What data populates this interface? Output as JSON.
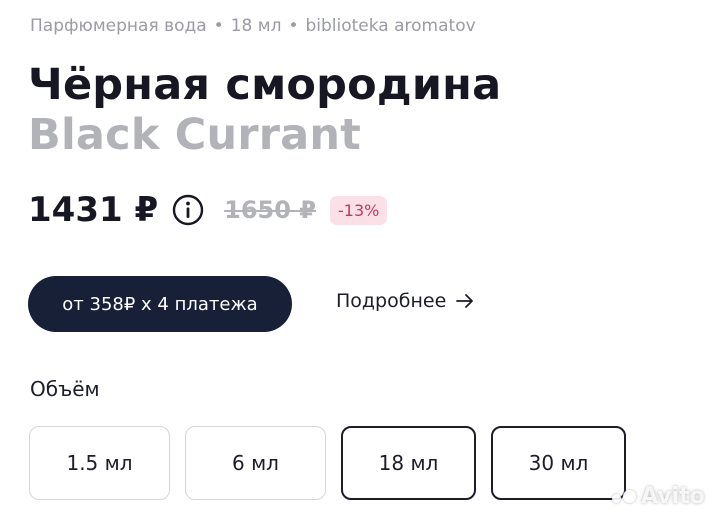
{
  "breadcrumb": {
    "type": "Парфюмерная вода",
    "volume": "18 мл",
    "brand": "biblioteka aromatov",
    "separator": "•"
  },
  "product": {
    "title": "Чёрная смородина",
    "subtitle": "Black Currant"
  },
  "pricing": {
    "price": "1431 ₽",
    "old_price": "1650 ₽",
    "discount": "-13%",
    "info_icon": "info-circle-icon"
  },
  "installment": {
    "button_label": "от 358₽ x 4 платежа",
    "more_label": "Подробнее",
    "more_icon": "arrow-right-icon"
  },
  "volume": {
    "label": "Объём",
    "options": [
      {
        "label": "1.5 мл",
        "state": "default"
      },
      {
        "label": "6 мл",
        "state": "default"
      },
      {
        "label": "18 мл",
        "state": "outlined"
      },
      {
        "label": "30 мл",
        "state": "outlined"
      }
    ]
  },
  "watermark": {
    "text": "Avito"
  },
  "colors": {
    "dark": "#172036",
    "muted": "#b1b3b8",
    "discount_bg": "#fbe0e7",
    "discount_text": "#c13a5d"
  }
}
